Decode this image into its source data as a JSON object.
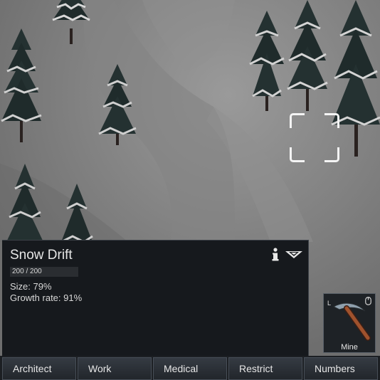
{
  "inspect": {
    "title": "Snow Drift",
    "bar_text": "200 / 200",
    "bar_fraction": 1.0,
    "size_text": "Size: 79%",
    "growth_text": "Growth rate: 91%",
    "info_icon": "info-icon",
    "collapse_icon": "collapse-arrow-icon"
  },
  "command": {
    "label": "Mine",
    "hotkey": "L",
    "icon": "pickaxe-icon"
  },
  "tabs": [
    "Architect",
    "Work",
    "Medical",
    "Restrict",
    "Numbers"
  ],
  "colors": {
    "panel": "#16191d",
    "tab": "#2c3137",
    "snow": "#8a8a8a",
    "tree": "#1f2b2b"
  }
}
